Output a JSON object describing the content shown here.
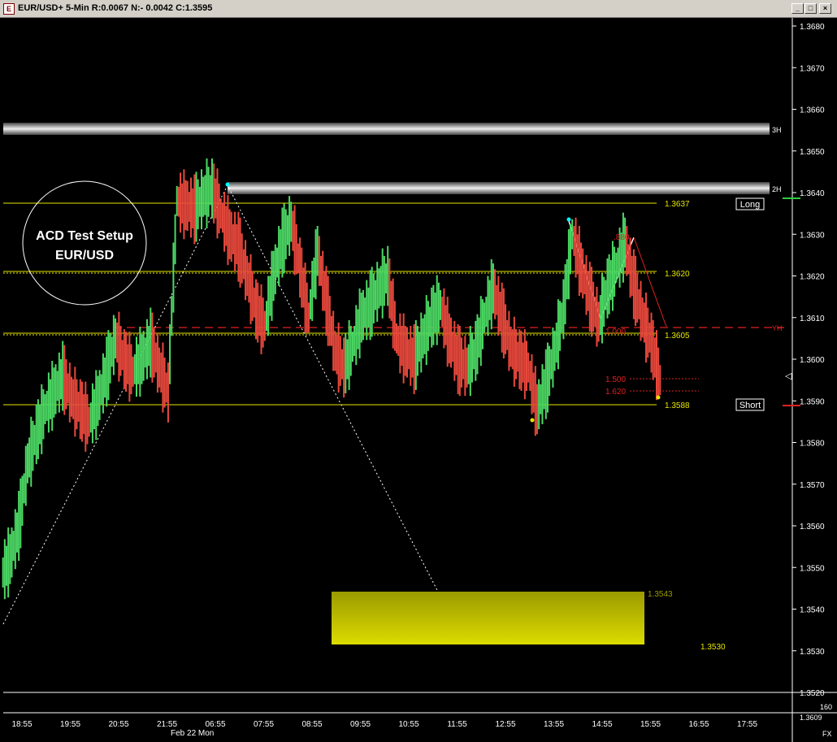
{
  "window": {
    "title": "EUR/USD+ 5-Min R:0.0067 N:- 0.0042 C:1.3595",
    "icon_label": "E",
    "buttons": [
      {
        "name": "minimize-icon",
        "glyph": "_"
      },
      {
        "name": "maximize-icon",
        "glyph": "□"
      },
      {
        "name": "close-icon",
        "glyph": "×"
      }
    ]
  },
  "chart": {
    "setup_label_line1": "ACD Test Setup",
    "setup_label_line2": "EUR/USD",
    "price_ticks": [
      "1.3680",
      "1.3670",
      "1.3660",
      "1.3650",
      "1.3640",
      "1.3630",
      "1.3620",
      "1.3610",
      "1.3600",
      "1.3590",
      "1.3580",
      "1.3570",
      "1.3560",
      "1.3550",
      "1.3540",
      "1.3530",
      "1.3520"
    ],
    "time_ticks": [
      "18:55",
      "19:55",
      "20:55",
      "21:55",
      "06:55",
      "07:55",
      "08:55",
      "09:55",
      "10:55",
      "11:55",
      "12:55",
      "13:55",
      "14:55",
      "15:55",
      "16:55",
      "17:55"
    ],
    "date_label": "Feb 22 Mon",
    "levels": {
      "long": "1.3637",
      "upper": "1.3620",
      "mid": "1.3605",
      "short": "1.3588",
      "target_top": "1.3543",
      "target_bottom": "1.3530"
    },
    "tags": {
      "long": "Long",
      "short": "Short",
      "h3": "3H",
      "h2": "2H",
      "yh": "YH",
      "fx": "FX"
    },
    "fib_labels": {
      "f880": ".880",
      "f1000": "1.000",
      "f1500": "1.500",
      "f1620": "1.620"
    },
    "volume_value": "160",
    "last_price": "1.3609"
  },
  "chart_data": {
    "type": "ohlc",
    "series": [
      {
        "name": "EUR/USD",
        "values": [
          1.3552,
          1.356,
          1.3575,
          1.3582,
          1.3588,
          1.3592,
          1.3596,
          1.3591,
          1.3588,
          1.3585,
          1.359,
          1.3597,
          1.3605,
          1.36,
          1.3597,
          1.36,
          1.3604,
          1.3598,
          1.3592,
          1.3638,
          1.3637,
          1.3636,
          1.3639,
          1.3641,
          1.3635,
          1.363,
          1.3627,
          1.362,
          1.3612,
          1.3608,
          1.362,
          1.3628,
          1.3633,
          1.3622,
          1.361,
          1.3626,
          1.3614,
          1.3602,
          1.3598,
          1.3603,
          1.361,
          1.3613,
          1.3617,
          1.362,
          1.3605,
          1.3602,
          1.36,
          1.3605,
          1.361,
          1.3613,
          1.3605,
          1.36,
          1.3598,
          1.3602,
          1.361,
          1.3617,
          1.361,
          1.3603,
          1.36,
          1.3598,
          1.3588,
          1.3594,
          1.3602,
          1.3612,
          1.363,
          1.3622,
          1.3615,
          1.3609,
          1.3617,
          1.3622,
          1.3628,
          1.3618,
          1.361,
          1.3604,
          1.3595
        ]
      }
    ],
    "ylim": [
      1.3515,
      1.3685
    ]
  }
}
